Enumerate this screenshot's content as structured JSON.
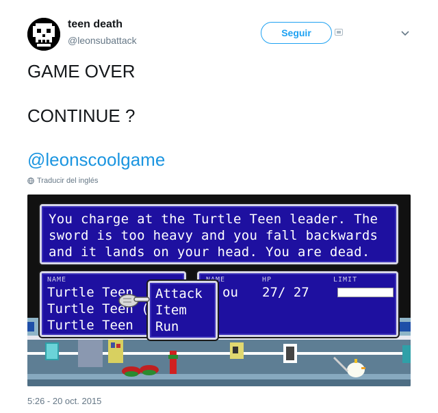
{
  "user": {
    "display_name": "teen death",
    "handle": "@leonsubattack"
  },
  "actions": {
    "follow_label": "Seguir"
  },
  "tweet": {
    "line1": "GAME OVER",
    "line2": "CONTINUE ?",
    "mention": "@leonscoolgame",
    "translate_label": "Traducir del inglés",
    "timestamp": "5:26 - 20 oct. 2015"
  },
  "game": {
    "message_lines": [
      "You charge at the Turtle Teen leader. The",
      "sword is too heavy and you fall backwards",
      "and it lands on your head. You are dead."
    ],
    "party": {
      "header": "NAME",
      "rows": [
        "Turtle Teen",
        "Turtle Teen (",
        "Turtle Teen"
      ]
    },
    "stats": {
      "headers": {
        "name": "NAME",
        "hp": "HP",
        "limit": "LIMIT"
      },
      "row": {
        "name": "ou",
        "hp": "27/ 27"
      },
      "limit_fraction": 0.0
    },
    "commands": [
      "Attack",
      "Item",
      "Run"
    ],
    "colors": {
      "window_blue": "#1e10a0",
      "window_border": "#d8d8e8"
    }
  },
  "icons": {
    "translate": "globe-icon",
    "caret": "chevron-down-icon",
    "follow_extra": "follow-extra-icon"
  }
}
